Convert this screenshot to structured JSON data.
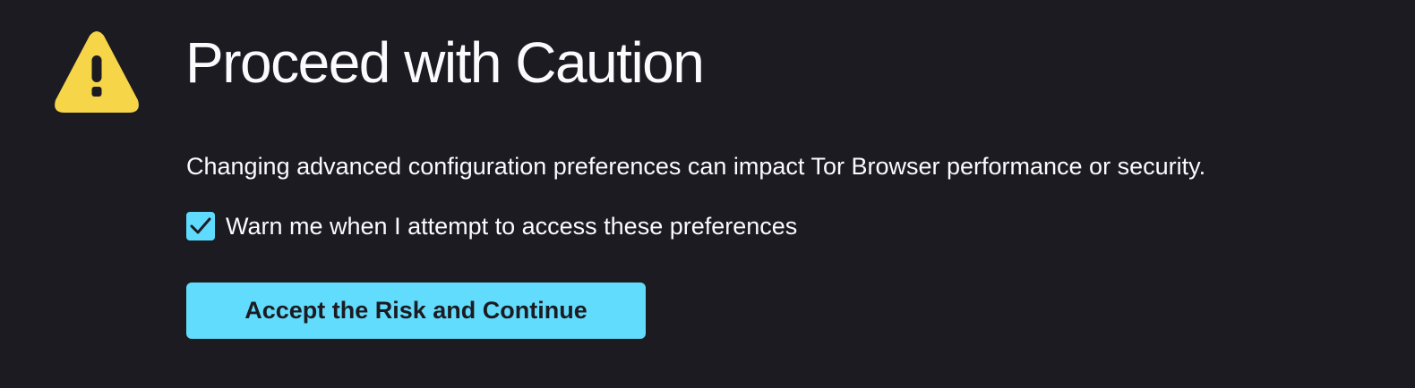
{
  "warning": {
    "icon": "warning-triangle-icon",
    "color": "#f6d549"
  },
  "title": "Proceed with Caution",
  "description": "Changing advanced configuration preferences can impact Tor Browser performance or security.",
  "warn_checkbox": {
    "label": "Warn me when I attempt to access these preferences",
    "checked": true,
    "color": "#5fdbff"
  },
  "accept_button": {
    "label": "Accept the Risk and Continue",
    "color": "#62dcfc"
  },
  "colors": {
    "background": "#1c1b22",
    "text": "#fbfbfe"
  }
}
